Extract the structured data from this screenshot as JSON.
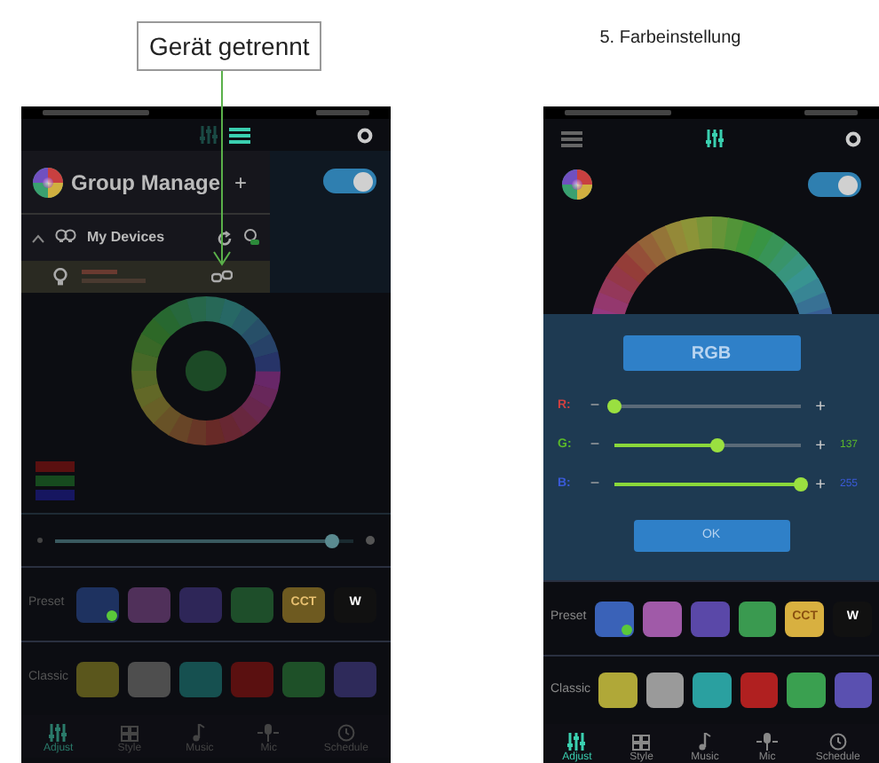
{
  "left": {
    "callout": "Gerät getrennt",
    "phone": {
      "toggle_on": true,
      "drawer": {
        "title": "Group Manage",
        "add": "+",
        "group": {
          "label": "My Devices",
          "expanded": true
        }
      },
      "rgb_chips": [
        {
          "color": "#5a1010"
        },
        {
          "color": "#164a1e"
        },
        {
          "color": "#161660"
        }
      ],
      "brightness": {
        "level": 0.93
      },
      "preset": {
        "label": "Preset",
        "swatches": [
          {
            "color": "#1e3260",
            "selected": true
          },
          {
            "color": "#50305a",
            "selected": false
          },
          {
            "color": "#2e2658",
            "selected": false
          },
          {
            "color": "#1e4e2a",
            "selected": false
          },
          {
            "color": "#6e5a20",
            "selected": false,
            "label": "CCT"
          },
          {
            "color": "#111111",
            "selected": false,
            "label": "W"
          }
        ]
      },
      "classic": {
        "label": "Classic",
        "swatches": [
          {
            "color": "#5a561c"
          },
          {
            "color": "#4e4e4e"
          },
          {
            "color": "#165050"
          },
          {
            "color": "#5a1010"
          },
          {
            "color": "#1e5028"
          },
          {
            "color": "#2e2a5a"
          }
        ]
      },
      "nav": [
        {
          "label": "Adjust",
          "selected": true
        },
        {
          "label": "Style",
          "selected": false
        },
        {
          "label": "Music",
          "selected": false
        },
        {
          "label": "Mic",
          "selected": false
        },
        {
          "label": "Schedule",
          "selected": false
        }
      ]
    }
  },
  "right": {
    "heading": "5. Farbeinstellung",
    "phone": {
      "toggle_on": true,
      "dialog": {
        "title": "RGB",
        "ok": "OK",
        "channels": [
          {
            "label": "R:",
            "color": "#d04040",
            "minus": "−",
            "plus": "+",
            "level": 0.0
          },
          {
            "label": "G:",
            "color": "#5ab82a",
            "minus": "−",
            "plus": "+",
            "level": 0.55,
            "reading": "137"
          },
          {
            "label": "B:",
            "color": "#3a5ad8",
            "minus": "−",
            "plus": "+",
            "level": 1.0,
            "reading": "255"
          }
        ]
      },
      "preset": {
        "label": "Preset",
        "swatches": [
          {
            "color": "#3a62b8",
            "selected": true
          },
          {
            "color": "#a05aa8",
            "selected": false
          },
          {
            "color": "#5a48a8",
            "selected": false
          },
          {
            "color": "#3a9a50",
            "selected": false
          },
          {
            "color": "#d8b040",
            "selected": false,
            "label": "CCT"
          },
          {
            "color": "#111111",
            "selected": false,
            "label": "W"
          }
        ]
      },
      "classic": {
        "label": "Classic",
        "swatches": [
          {
            "color": "#b0a838"
          },
          {
            "color": "#9a9a9a"
          },
          {
            "color": "#2aa0a0"
          },
          {
            "color": "#b02020"
          },
          {
            "color": "#3aa050"
          },
          {
            "color": "#5a50b0"
          }
        ]
      },
      "nav": [
        {
          "label": "Adjust",
          "selected": true
        },
        {
          "label": "Style",
          "selected": false
        },
        {
          "label": "Music",
          "selected": false
        },
        {
          "label": "Mic",
          "selected": false
        },
        {
          "label": "Schedule",
          "selected": false
        }
      ]
    }
  }
}
